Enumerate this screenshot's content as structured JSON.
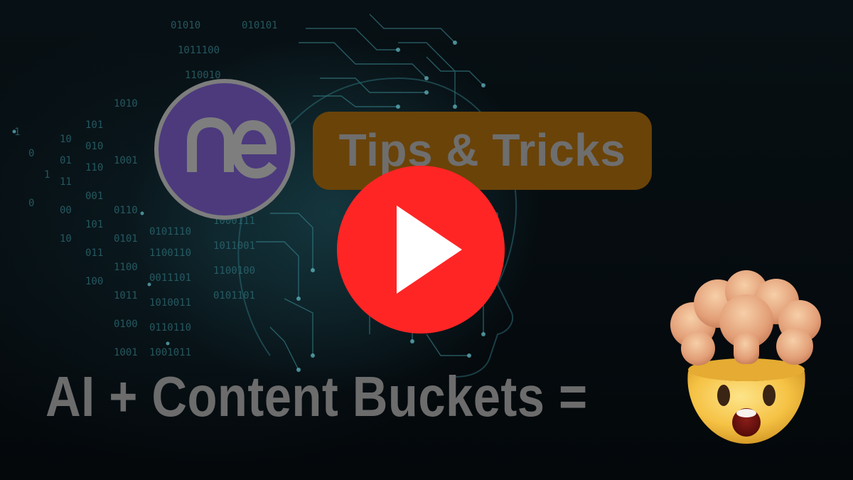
{
  "thumbnail": {
    "logo_text": "ne",
    "badge_label": "Tips & Tricks",
    "headline": "AI + Content Buckets =",
    "play_icon": "play-icon",
    "emoji_icon": "mind-blown-emoji-icon",
    "colors": {
      "logo_fill": "#4c3a7d",
      "logo_ring": "#7d7d7d",
      "badge_fill": "#6a4309",
      "text_gray": "#6c6c6c",
      "play_red": "#ff2525",
      "background": "#05090c"
    }
  }
}
